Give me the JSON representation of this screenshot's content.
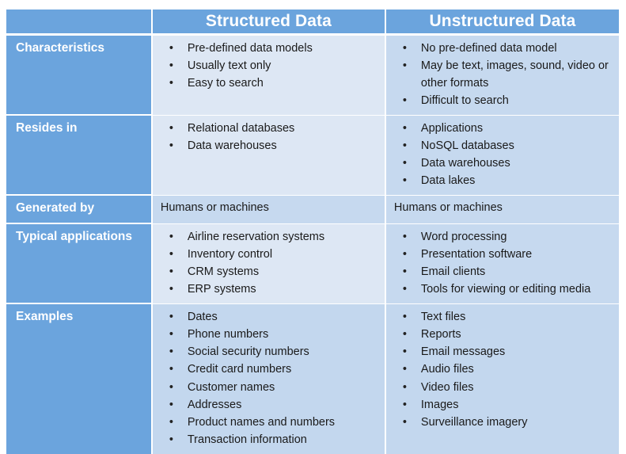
{
  "colors": {
    "header_blue": "#6ba4dd",
    "label_blue": "#6ba4dd",
    "cell_light": "#dde7f4",
    "cell_mid": "#c6d9ef",
    "cell_dark": "#c3d7ee",
    "text_dark": "#1a1a1a",
    "text_light": "#ffffff",
    "page_background": "#ffffff"
  },
  "table": {
    "corner_label": "",
    "columns": [
      "Structured Data",
      "Unstructured Data"
    ],
    "rows": [
      {
        "label": "Characteristics",
        "structured": {
          "type": "bullets",
          "items": [
            "Pre-defined data models",
            "Usually text only",
            "Easy to search"
          ]
        },
        "unstructured": {
          "type": "bullets",
          "items": [
            "No pre-defined data model",
            "May be text, images, sound, video or other formats",
            "Difficult to search"
          ]
        }
      },
      {
        "label": "Resides in",
        "structured": {
          "type": "bullets",
          "items": [
            "Relational databases",
            "Data warehouses"
          ]
        },
        "unstructured": {
          "type": "bullets",
          "items": [
            "Applications",
            "NoSQL databases",
            "Data warehouses",
            "Data lakes"
          ]
        }
      },
      {
        "label": "Generated by",
        "structured": {
          "type": "text",
          "text": "Humans or machines"
        },
        "unstructured": {
          "type": "text",
          "text": "Humans or machines"
        }
      },
      {
        "label": "Typical applications",
        "structured": {
          "type": "bullets",
          "items": [
            "Airline reservation systems",
            "Inventory control",
            "CRM systems",
            "ERP systems"
          ]
        },
        "unstructured": {
          "type": "bullets",
          "items": [
            "Word processing",
            "Presentation software",
            "Email clients",
            "Tools for viewing or editing media"
          ]
        }
      },
      {
        "label": "Examples",
        "structured": {
          "type": "bullets",
          "items": [
            "Dates",
            "Phone numbers",
            "Social security numbers",
            "Credit card numbers",
            "Customer names",
            "Addresses",
            "Product names and numbers",
            "Transaction information"
          ]
        },
        "unstructured": {
          "type": "bullets",
          "items": [
            "Text files",
            "Reports",
            "Email messages",
            "Audio files",
            "Video files",
            "Images",
            "Surveillance imagery"
          ]
        }
      }
    ],
    "bullet_glyph": "•"
  }
}
